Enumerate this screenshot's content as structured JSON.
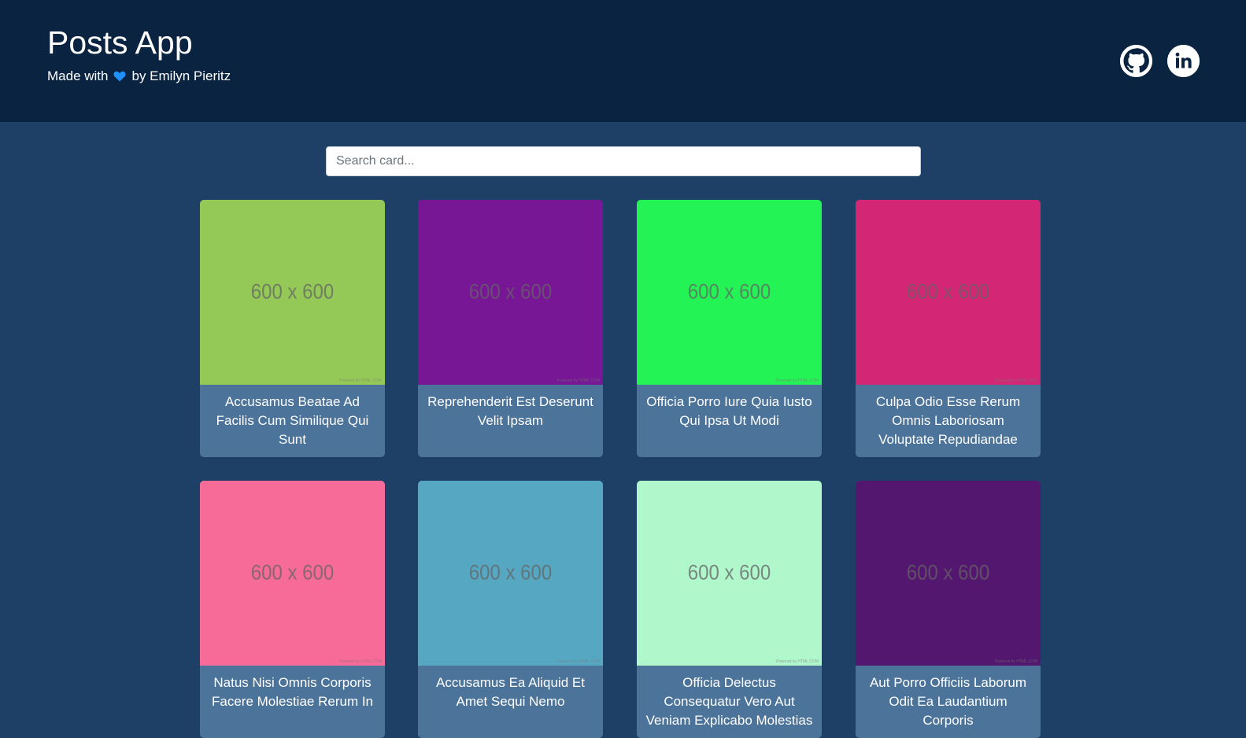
{
  "header": {
    "title": "Posts App",
    "made_with": "Made with",
    "by": "by Emilyn Pieritz",
    "heart_color": "#1e90ff",
    "links": [
      {
        "name": "github-icon"
      },
      {
        "name": "linkedin-icon"
      }
    ]
  },
  "search": {
    "placeholder": "Search card..."
  },
  "cards": [
    {
      "color": "#94c957",
      "image_text": "600 x 600",
      "powered": "Powered by HTML.COM",
      "caption": "Accusamus Beatae Ad Facilis Cum Similique Qui Sunt"
    },
    {
      "color": "#771796",
      "image_text": "600 x 600",
      "powered": "Powered by HTML.COM",
      "caption": "Reprehenderit Est Deserunt Velit Ipsam"
    },
    {
      "color": "#24f355",
      "image_text": "600 x 600",
      "powered": "Powered by HTML.COM",
      "caption": "Officia Porro Iure Quia Iusto Qui Ipsa Ut Modi"
    },
    {
      "color": "#d32776",
      "image_text": "600 x 600",
      "powered": "Powered by HTML.COM",
      "caption": "Culpa Odio Esse Rerum Omnis Laboriosam Voluptate Repudiandae"
    },
    {
      "color": "#f66b97",
      "image_text": "600 x 600",
      "powered": "Powered by HTML.COM",
      "caption": "Natus Nisi Omnis Corporis Facere Molestiae Rerum In"
    },
    {
      "color": "#56a8c2",
      "image_text": "600 x 600",
      "powered": "Powered by HTML.COM",
      "caption": "Accusamus Ea Aliquid Et Amet Sequi Nemo"
    },
    {
      "color": "#b0f7cc",
      "image_text": "600 x 600",
      "powered": "Powered by HTML.COM",
      "caption": "Officia Delectus Consequatur Vero Aut Veniam Explicabo Molestias"
    },
    {
      "color": "#54176f",
      "image_text": "600 x 600",
      "powered": "Powered by HTML.COM",
      "caption": "Aut Porro Officiis Laborum Odit Ea Laudantium Corporis"
    }
  ]
}
